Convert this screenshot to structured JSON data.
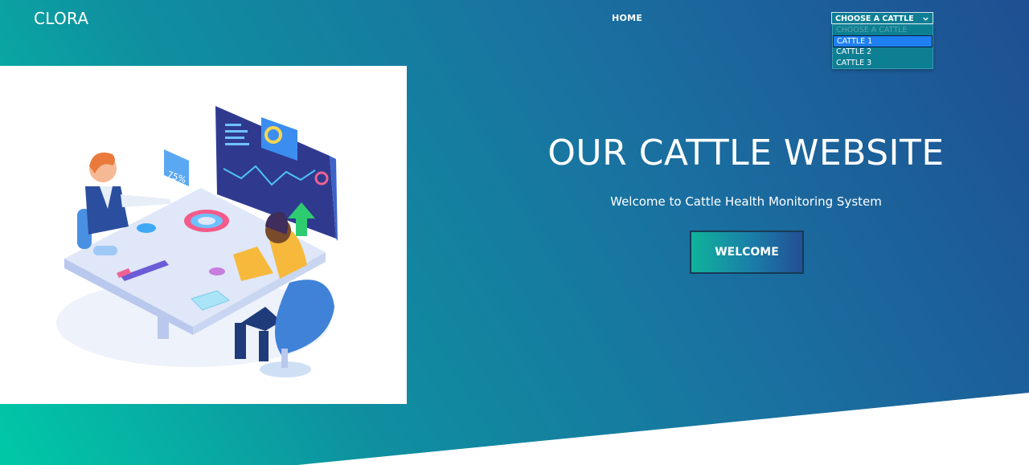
{
  "header": {
    "logo": "CLORA",
    "nav": {
      "home": "HOME"
    },
    "select": {
      "label": "CHOOSE A CATTLE",
      "options": [
        "CHOOSE A CATTLE",
        "CATTLE 1",
        "CATTLE 2",
        "CATTLE 3"
      ],
      "highlighted": "CATTLE 1"
    }
  },
  "hero": {
    "title": "OUR CATTLE WEBSITE",
    "subtitle": "Welcome to Cattle Health Monitoring System",
    "button": "WELCOME",
    "illustration": {
      "badge_text": "75%"
    }
  },
  "colors": {
    "gradient_start": "#00c9a7",
    "gradient_end": "#1e4f92",
    "highlight": "#1e7ff0"
  },
  "icons": {
    "select_arrow": "chevron-down-icon",
    "trend": "arrow-up-icon"
  }
}
